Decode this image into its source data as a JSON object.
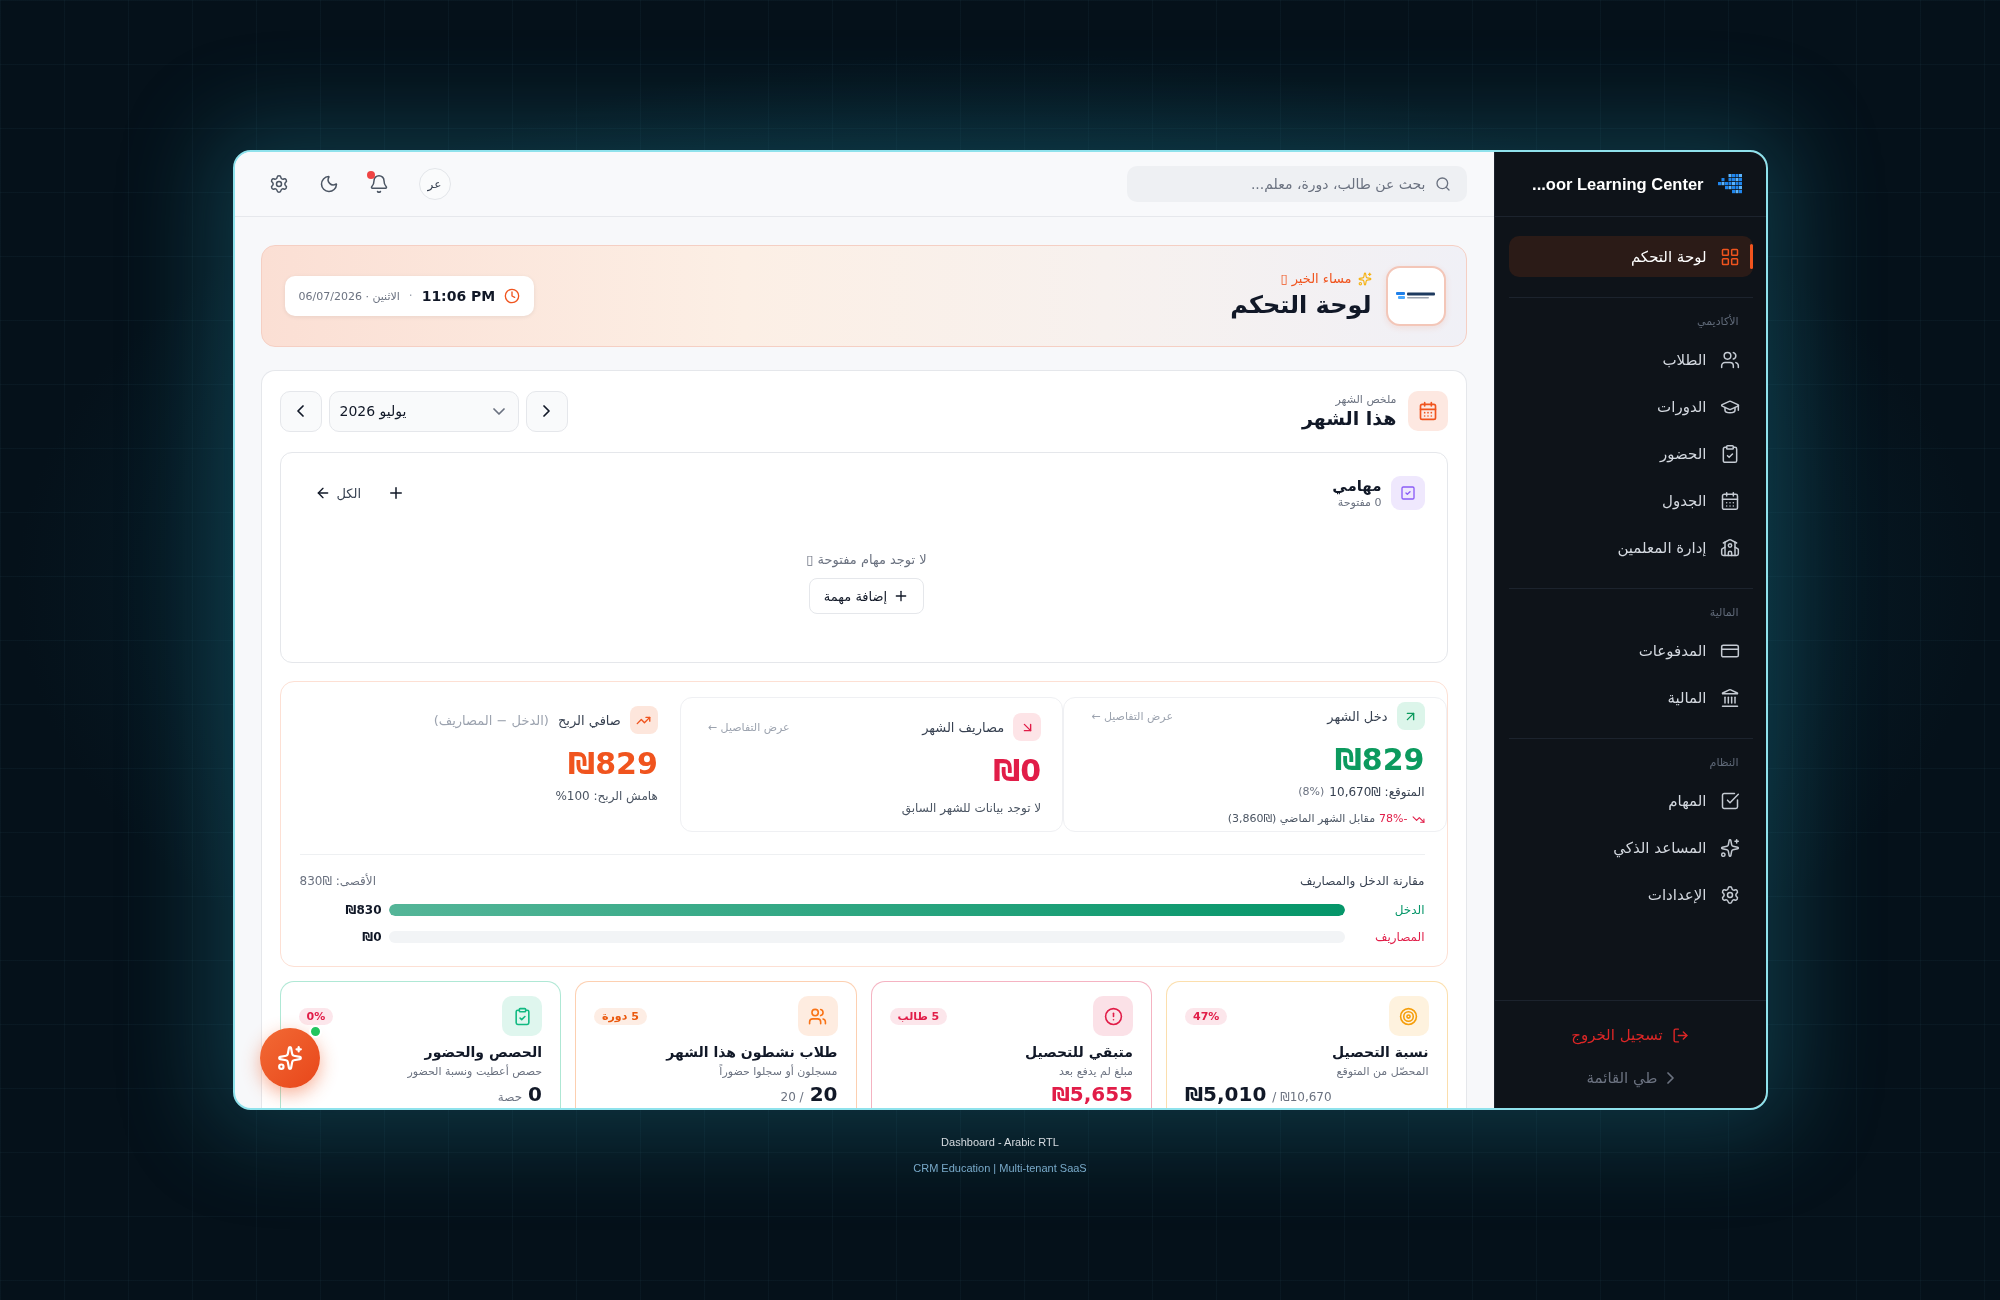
{
  "sidebar": {
    "brand": "...oor Learning Center",
    "items": [
      {
        "label": "لوحة التحكم",
        "selected": true
      }
    ],
    "sections": [
      {
        "title": "الأكاديمي",
        "items": [
          {
            "label": "الطلاب",
            "selected": false
          },
          {
            "label": "الدورات",
            "selected": false
          },
          {
            "label": "الحضور",
            "selected": false
          },
          {
            "label": "الجدول",
            "selected": false
          },
          {
            "label": "إدارة المعلمين",
            "selected": false
          }
        ]
      },
      {
        "title": "المالية",
        "items": [
          {
            "label": "المدفوعات",
            "selected": false
          },
          {
            "label": "المالية",
            "selected": false
          }
        ]
      },
      {
        "title": "النظام",
        "items": [
          {
            "label": "المهام",
            "selected": false
          },
          {
            "label": "المساعد الذكي",
            "selected": false
          },
          {
            "label": "الإعدادات",
            "selected": false
          }
        ]
      }
    ],
    "logout": "تسجيل الخروج",
    "collapse": "طي القائمة"
  },
  "topbar": {
    "search": {
      "placeholder": "بحث عن طالب، دورة، معلم..."
    },
    "language": "عر",
    "notifications": {
      "unread": true
    }
  },
  "banner": {
    "greeting": "مساء الخير ▯",
    "title": "لوحة التحكم",
    "time": "11:06 PM",
    "separator": "·",
    "date": "الاثنين · 06/07/2026"
  },
  "month": {
    "caption": "ملخص الشهر",
    "title": "هذا الشهر",
    "month_picker": {
      "value": "يوليو 2026"
    },
    "tasks": {
      "title": "مهامي",
      "count": "0 مفتوحة",
      "all_link": "الكل",
      "empty_message": "لا توجد مهام مفتوحة ▯",
      "add_button": "إضافة مهمة"
    },
    "finance": {
      "cards": [
        {
          "kind": "income",
          "label": "دخل الشهر",
          "link": "عرض التفاصيل ←",
          "amount": "₪829",
          "expected": "المتوقع: ₪10,670",
          "expected_share": "(8%)",
          "change": "-78%",
          "comparison": "مقابل الشهر الماضي (₪3,860)"
        },
        {
          "kind": "expense",
          "label": "مصاريف الشهر",
          "link": "عرض التفاصيل ←",
          "amount": "₪0",
          "note": "لا توجد بيانات للشهر السابق"
        },
        {
          "kind": "profit",
          "label": "صافي الربح",
          "label_note": "(الدخل − المصاريف)",
          "amount": "₪829",
          "note": "هامش الربح: 100%"
        }
      ],
      "comparison": {
        "title": "مقارنة الدخل والمصاريف",
        "max": "الأقصى: ₪830",
        "bars": [
          {
            "label": "الدخل",
            "value": "₪830",
            "level": 1,
            "color": "#059669"
          },
          {
            "label": "المصاريف",
            "value": "₪0",
            "level": 0,
            "color": "#e11d48"
          }
        ]
      }
    },
    "stats": [
      {
        "kind": "progress",
        "title": "نسبة التحصيل",
        "subtitle": "المحصّل من المتوقع",
        "badge": {
          "label": "47%",
          "color": "#e11d48"
        },
        "value": "₪5,010",
        "value_note": "/ ₪10,670",
        "color": "#f59e0b"
      },
      {
        "kind": "alert",
        "title": "متبقي للتحصيل",
        "subtitle": "مبلغ لم يدفع بعد",
        "badge": {
          "label": "5 طالب",
          "color": "#e11d48"
        },
        "value": "₪5,655",
        "color": "#e11d48"
      },
      {
        "kind": "figure",
        "title": "طلاب نشطون هذا الشهر",
        "subtitle": "مسجلون أو سجلوا حضوراً",
        "badge": {
          "label": "5 دورة",
          "color": "#ea580c"
        },
        "value": "20",
        "value_note": "/ 20",
        "color": "#f97316"
      },
      {
        "kind": "figure",
        "title": "الحصص والحضور",
        "subtitle": "حصص أعطيت ونسبة الحضور",
        "badge": {
          "label": "0%",
          "color": "#e11d48"
        },
        "value": "0",
        "value_note": "حصة",
        "color": "#10b981"
      }
    ]
  },
  "assistant_button": {
    "online": true
  },
  "footer": {
    "title": "Dashboard - Arabic RTL",
    "subtitle": "CRM Education | Multi-tenant SaaS"
  }
}
